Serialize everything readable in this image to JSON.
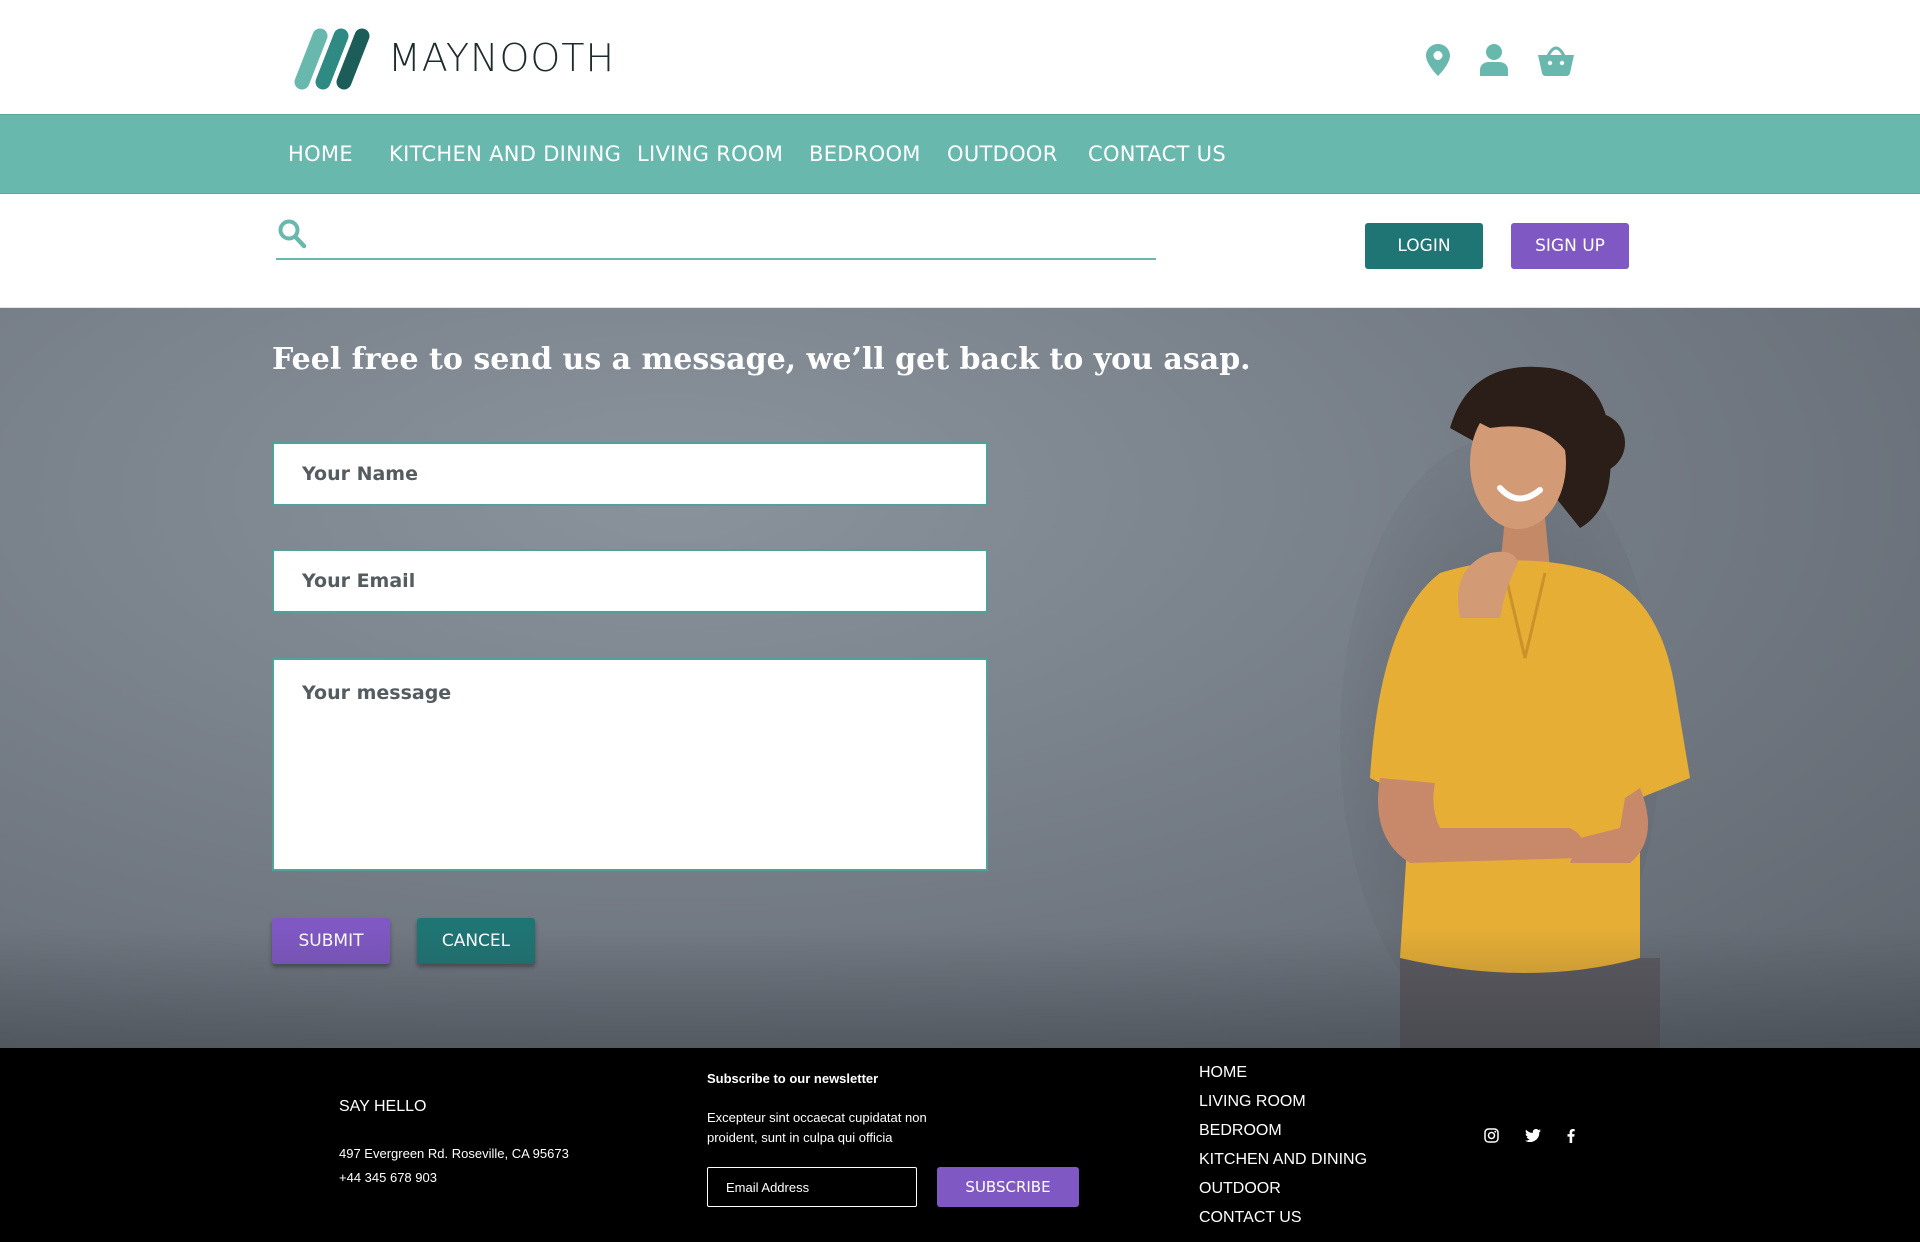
{
  "brand": {
    "name": "MAYNOOTH"
  },
  "colors": {
    "teal": "#69b8ae",
    "dark_teal": "#1f7574",
    "purple": "#7f58c3",
    "footer_bg": "#000000"
  },
  "header": {
    "icons": [
      "location-pin-icon",
      "user-icon",
      "shopping-basket-icon"
    ]
  },
  "nav": {
    "items": [
      "HOME",
      "KITCHEN AND DINING",
      "LIVING ROOM",
      "BEDROOM",
      "OUTDOOR",
      "CONTACT US"
    ]
  },
  "search": {
    "placeholder": "",
    "login_label": "LOGIN",
    "signup_label": "SIGN UP"
  },
  "contact": {
    "title": "Feel free to send us a message, we’ll get back to you asap.",
    "name_placeholder": "Your Name",
    "email_placeholder": "Your Email",
    "message_placeholder": "Your message",
    "submit_label": "SUBMIT",
    "cancel_label": "CANCEL"
  },
  "footer": {
    "say_hello": "SAY HELLO",
    "address": "497 Evergreen Rd. Roseville, CA 95673",
    "phone": "+44 345 678 903",
    "newsletter_title": "Subscribe to our newsletter",
    "newsletter_text": "Excepteur sint occaecat cupidatat non proident, sunt in culpa qui officia",
    "email_placeholder": "Email Address",
    "subscribe_label": "SUBSCRIBE",
    "nav": [
      "HOME",
      "LIVING ROOM",
      "BEDROOM",
      "KITCHEN AND DINING",
      "OUTDOOR",
      "CONTACT US"
    ],
    "social": [
      "instagram-icon",
      "twitter-icon",
      "facebook-icon"
    ]
  }
}
